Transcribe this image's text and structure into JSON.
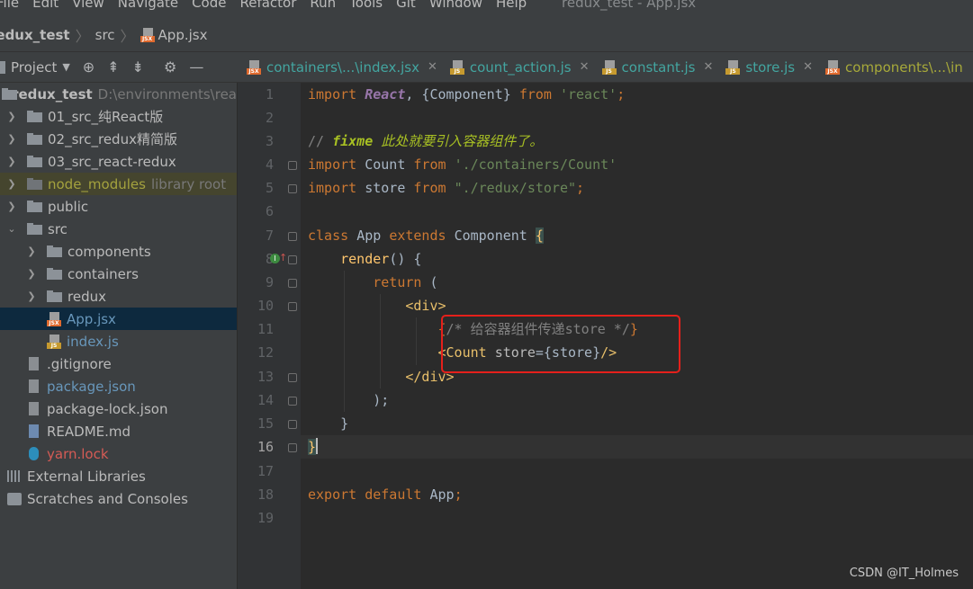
{
  "menubar": {
    "items": [
      "File",
      "Edit",
      "View",
      "Navigate",
      "Code",
      "Refactor",
      "Run",
      "Tools",
      "Git",
      "Window",
      "Help"
    ],
    "window_title": "redux_test - App.jsx"
  },
  "breadcrumb": {
    "items": [
      "redux_test",
      "src",
      "App.jsx"
    ]
  },
  "project_panel": {
    "title": "Project"
  },
  "tabs": [
    {
      "label": "containers\\...\\index.jsx",
      "icon": "jsx-file-icon"
    },
    {
      "label": "count_action.js",
      "icon": "js-file-icon"
    },
    {
      "label": "constant.js",
      "icon": "js-file-icon"
    },
    {
      "label": "store.js",
      "icon": "js-file-icon"
    },
    {
      "label": "components\\...\\in",
      "icon": "jsx-file-icon"
    }
  ],
  "tree": [
    {
      "label": "redux_test",
      "extra": "D:\\environments\\rea"
    },
    {
      "label": "01_src_纯React版"
    },
    {
      "label": "02_src_redux精简版"
    },
    {
      "label": "03_src_react-redux"
    },
    {
      "label": "node_modules",
      "extra": "library root"
    },
    {
      "label": "public"
    },
    {
      "label": "src"
    },
    {
      "label": "components"
    },
    {
      "label": "containers"
    },
    {
      "label": "redux"
    },
    {
      "label": "App.jsx"
    },
    {
      "label": "index.js"
    },
    {
      "label": ".gitignore"
    },
    {
      "label": "package.json"
    },
    {
      "label": "package-lock.json"
    },
    {
      "label": "README.md"
    },
    {
      "label": "yarn.lock"
    },
    {
      "label": "External Libraries"
    },
    {
      "label": "Scratches and Consoles"
    }
  ],
  "line_numbers": [
    "1",
    "2",
    "3",
    "4",
    "5",
    "6",
    "7",
    "8",
    "9",
    "10",
    "11",
    "12",
    "13",
    "14",
    "15",
    "16",
    "17",
    "18",
    "19"
  ],
  "code": {
    "l1_a": "import ",
    "l1_b": "React",
    "l1_c": ", {Component} ",
    "l1_d": "from ",
    "l1_e": "'react'",
    "l1_f": ";",
    "l3_a": "// ",
    "l3_b": "fixme",
    "l3_c": " 此处就要引入容器组件了。",
    "l4_a": "import ",
    "l4_b": "Count ",
    "l4_c": "from ",
    "l4_d": "'./containers/Count'",
    "l5_a": "import ",
    "l5_b": "store ",
    "l5_c": "from ",
    "l5_d": "\"./redux/store\"",
    "l5_e": ";",
    "l7_a": "class ",
    "l7_b": "App ",
    "l7_c": "extends ",
    "l7_d": "Component ",
    "l7_e": "{",
    "l8_a": "    ",
    "l8_b": "render",
    "l8_c": "() {",
    "l9_a": "        ",
    "l9_b": "return ",
    "l9_c": "(",
    "l10_a": "            ",
    "l10_b": "<div>",
    "l11_a": "                ",
    "l11_b": "{",
    "l11_c": "/* 给容器组件传递store */",
    "l11_d": "}",
    "l12_a": "                ",
    "l12_b": "<Count ",
    "l12_c": "store",
    "l12_d": "={store}",
    "l12_e": "/>",
    "l13_a": "            ",
    "l13_b": "</div>",
    "l14_a": "        ",
    "l14_b": ");",
    "l15_a": "    ",
    "l15_b": "}",
    "l16_a": "}",
    "l18_a": "export ",
    "l18_b": "default ",
    "l18_c": "App",
    "l18_d": ";"
  },
  "watermark": "CSDN @IT_Holmes",
  "colors": {
    "highlight_box": "#e5201b",
    "keyword": "#cc7832",
    "string": "#6a8759"
  }
}
